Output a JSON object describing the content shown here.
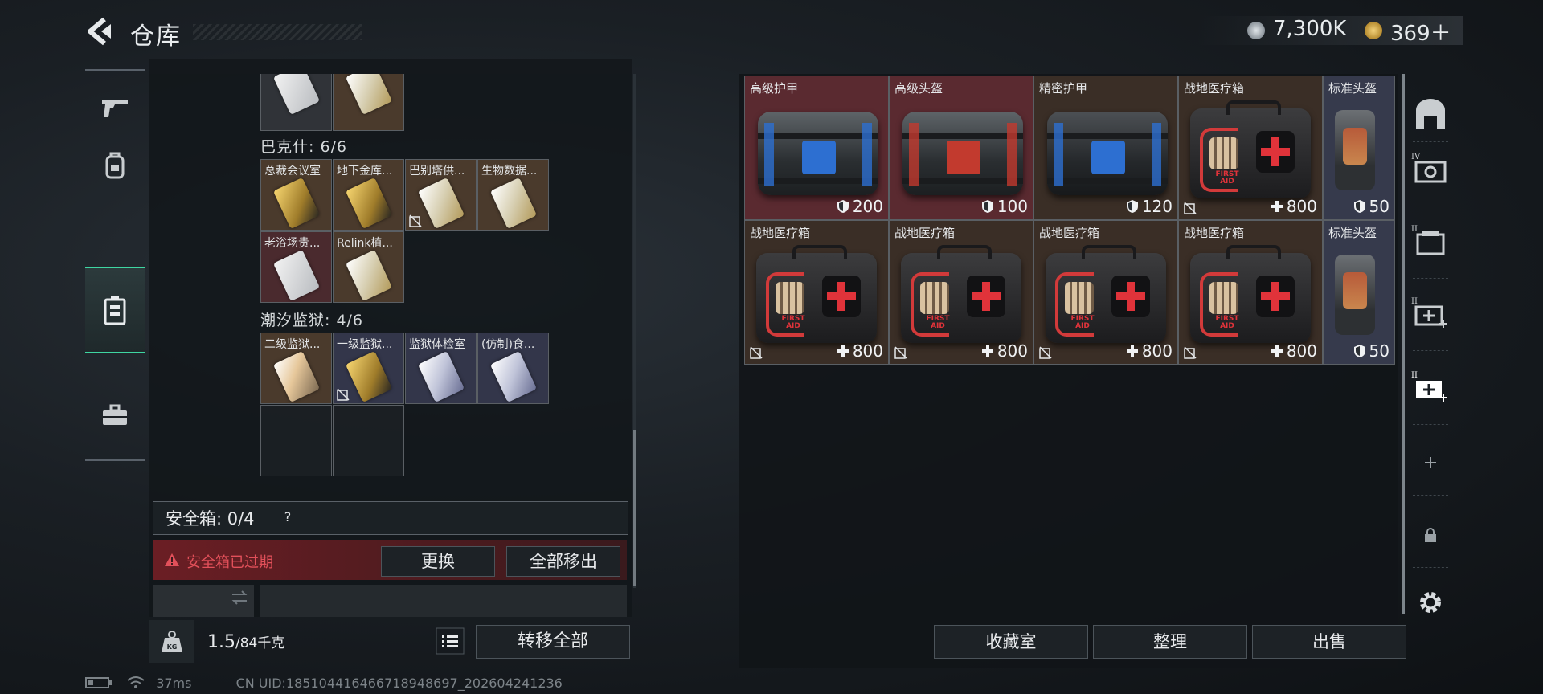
{
  "header": {
    "title": "仓库"
  },
  "currency": {
    "silver": "7,300K",
    "gold": "369＋"
  },
  "left_nav": {
    "items": [
      "weapons-tab",
      "backpack-tab",
      "containers-tab",
      "toolbox-tab"
    ],
    "active": 2
  },
  "inventory": {
    "sections": [
      {
        "label": "巴克什: 6/6",
        "cards": [
          {
            "name": "总裁会议室",
            "style": "gold",
            "bg": "brown",
            "nodrop": false
          },
          {
            "name": "地下金库...",
            "style": "gold",
            "bg": "brown",
            "nodrop": false
          },
          {
            "name": "巴别塔供...",
            "style": "ltgold",
            "bg": "brown",
            "nodrop": true
          },
          {
            "name": "生物数据...",
            "style": "ltgold",
            "bg": "brown",
            "nodrop": false
          },
          {
            "name": "老浴场贵...",
            "style": "white",
            "bg": "red",
            "nodrop": false
          },
          {
            "name": "Relink植...",
            "style": "ltgold",
            "bg": "brown",
            "nodrop": false
          }
        ]
      },
      {
        "label": "潮汐监狱: 4/6",
        "cards": [
          {
            "name": "二级监狱...",
            "style": "orange",
            "bg": "brown",
            "nodrop": false
          },
          {
            "name": "一级监狱...",
            "style": "gold",
            "bg": "blue",
            "nodrop": true
          },
          {
            "name": "监狱体检室",
            "style": "blue",
            "bg": "blue",
            "nodrop": false
          },
          {
            "name": "(仿制)食...",
            "style": "blue",
            "bg": "blue",
            "nodrop": false
          }
        ]
      }
    ]
  },
  "safebox": {
    "label": "安全箱: 0/4",
    "help": "?",
    "expired_text": "安全箱已过期",
    "replace_label": "更换",
    "remove_all_label": "全部移出"
  },
  "weight": {
    "current": "1.5",
    "max": "/84千克"
  },
  "transfer_all_label": "转移全部",
  "status_bar": {
    "ping": "37ms",
    "uid": "CN UID:185104416466718948697_202604241236"
  },
  "stash": {
    "items": [
      {
        "name": "高级护甲",
        "value": "200",
        "kind": "armor",
        "bg": "#5a2a30",
        "accent": "#2d6fd1",
        "value_icon": "shield"
      },
      {
        "name": "高级头盔",
        "value": "100",
        "kind": "armor",
        "bg": "#5a2a30",
        "accent": "#c23a2e",
        "value_icon": "shield"
      },
      {
        "name": "精密护甲",
        "value": "120",
        "kind": "armor-gray",
        "bg": "#3a2e26",
        "accent": "#2d6fd1",
        "value_icon": "shield"
      },
      {
        "name": "战地医疗箱",
        "value": "800",
        "kind": "medkit",
        "bg": "#3a2e26",
        "accent": "#e0333a",
        "value_icon": "plus",
        "nodrop": true
      },
      {
        "name": "标准头盔",
        "value": "50",
        "kind": "helmet",
        "bg": "#363a4c",
        "accent": "#c85a33",
        "value_icon": "shield"
      },
      {
        "name": "战地医疗箱",
        "value": "800",
        "kind": "medkit",
        "bg": "#3a2e26",
        "accent": "#e0333a",
        "value_icon": "plus",
        "nodrop": true
      },
      {
        "name": "战地医疗箱",
        "value": "800",
        "kind": "medkit",
        "bg": "#3a2e26",
        "accent": "#e0333a",
        "value_icon": "plus",
        "nodrop": true
      },
      {
        "name": "战地医疗箱",
        "value": "800",
        "kind": "medkit",
        "bg": "#3a2e26",
        "accent": "#e0333a",
        "value_icon": "plus",
        "nodrop": true
      },
      {
        "name": "战地医疗箱",
        "value": "800",
        "kind": "medkit",
        "bg": "#3a2e26",
        "accent": "#e0333a",
        "value_icon": "plus",
        "nodrop": true
      },
      {
        "name": "标准头盔",
        "value": "50",
        "kind": "helmet",
        "bg": "#363a4c",
        "accent": "#c85a33",
        "value_icon": "shield"
      }
    ],
    "medkit_label": "FIRST AID"
  },
  "right_nav": {
    "items": [
      "storage-main-icon",
      "storage-4-icon",
      "storage-2-icon",
      "storage-add-icon",
      "storage-add-active-icon",
      "add-storage-icon",
      "lock-icon",
      "settings-icon"
    ],
    "numerals": [
      "IV",
      "II",
      "II",
      "II"
    ]
  },
  "bottom_buttons": {
    "collection": "收藏室",
    "sort": "整理",
    "sell": "出售"
  },
  "colors": {
    "accent_green": "#3fd6a2",
    "alert_red": "#e2505a"
  }
}
